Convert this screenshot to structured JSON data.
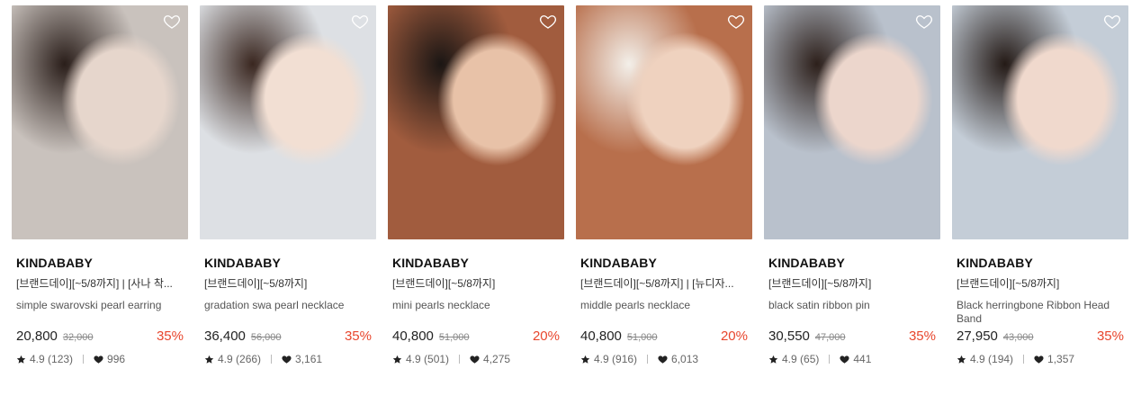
{
  "colors": {
    "discount": "#e8462d",
    "text": "#222222",
    "muted": "#666666"
  },
  "products": [
    {
      "brand": "KINDABABY",
      "promo": "[브랜드데이][~5/8까지] | [사나 착...",
      "name": "simple swarovski pearl earring",
      "price": "20,800",
      "original_price": "32,000",
      "discount": "35%",
      "rating": "4.9",
      "reviews": "(123)",
      "likes": "996",
      "image_icon": "pearl-earring-photo",
      "palette": [
        "#c9c2bd",
        "#e6d6cc",
        "#2a1e1a"
      ]
    },
    {
      "brand": "KINDABABY",
      "promo": "[브랜드데이][~5/8까지]",
      "name": "gradation swa pearl necklace",
      "price": "36,400",
      "original_price": "56,000",
      "discount": "35%",
      "rating": "4.9",
      "reviews": "(266)",
      "likes": "3,161",
      "image_icon": "pearl-necklace-photo",
      "palette": [
        "#dde0e4",
        "#f2dfd3",
        "#3a2720"
      ]
    },
    {
      "brand": "KINDABABY",
      "promo": "[브랜드데이][~5/8까지]",
      "name": "mini pearls necklace",
      "price": "40,800",
      "original_price": "51,000",
      "discount": "20%",
      "rating": "4.9",
      "reviews": "(501)",
      "likes": "4,275",
      "image_icon": "mini-pearl-photo",
      "palette": [
        "#a15c3e",
        "#e8c2a8",
        "#1b1614"
      ]
    },
    {
      "brand": "KINDABABY",
      "promo": "[브랜드데이][~5/8까지] | [뉴디자...",
      "name": "middle pearls necklace",
      "price": "40,800",
      "original_price": "51,000",
      "discount": "20%",
      "rating": "4.9",
      "reviews": "(916)",
      "likes": "6,013",
      "image_icon": "middle-pearl-photo",
      "palette": [
        "#b86f4c",
        "#efd2bf",
        "#f3efe9"
      ]
    },
    {
      "brand": "KINDABABY",
      "promo": "[브랜드데이][~5/8까지]",
      "name": "black satin ribbon pin",
      "price": "30,550",
      "original_price": "47,000",
      "discount": "35%",
      "rating": "4.9",
      "reviews": "(65)",
      "likes": "441",
      "image_icon": "ribbon-pin-photo",
      "palette": [
        "#b9c1cc",
        "#ecd6cc",
        "#2d201b"
      ]
    },
    {
      "brand": "KINDABABY",
      "promo": "[브랜드데이][~5/8까지]",
      "name": "Black herringbone Ribbon Head Band",
      "price": "27,950",
      "original_price": "43,000",
      "discount": "35%",
      "rating": "4.9",
      "reviews": "(194)",
      "likes": "1,357",
      "image_icon": "head-band-photo",
      "palette": [
        "#c4cdd7",
        "#f0d9cd",
        "#241a16"
      ]
    }
  ]
}
